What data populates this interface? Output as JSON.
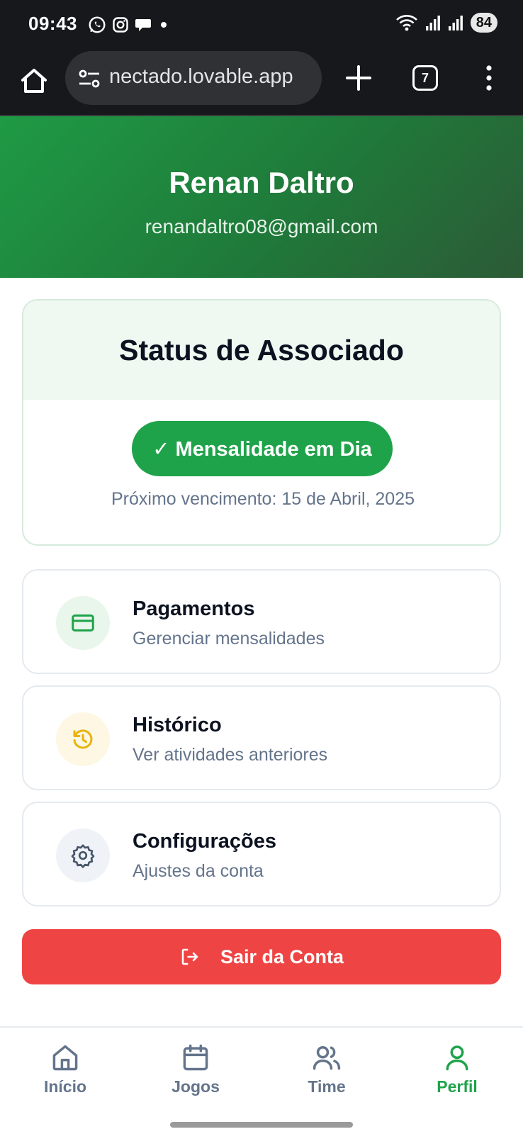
{
  "status_bar": {
    "time": "09:43",
    "notification_icons": [
      "whatsapp-icon",
      "instagram-icon",
      "chat-icon",
      "dot-icon"
    ],
    "battery": "84"
  },
  "browser": {
    "url": "nectado.lovable.app",
    "tab_count": "7"
  },
  "profile": {
    "name": "Renan Daltro",
    "email": "renandaltro08@gmail.com"
  },
  "status_card": {
    "title": "Status de Associado",
    "badge": "✓ Mensalidade em Dia",
    "due_text": "Próximo vencimento: 15 de Abril, 2025",
    "accent": "#1fa34a"
  },
  "menu": [
    {
      "title": "Pagamentos",
      "subtitle": "Gerenciar mensalidades",
      "icon": "credit-card-icon",
      "color": "#1fa34a"
    },
    {
      "title": "Histórico",
      "subtitle": "Ver atividades anteriores",
      "icon": "history-icon",
      "color": "#eab308"
    },
    {
      "title": "Configurações",
      "subtitle": "Ajustes da conta",
      "icon": "gear-icon",
      "color": "#475569"
    }
  ],
  "logout": {
    "label": "Sair da Conta",
    "color": "#ef4444"
  },
  "nav": [
    {
      "label": "Início",
      "icon": "home-icon",
      "active": false
    },
    {
      "label": "Jogos",
      "icon": "calendar-icon",
      "active": false
    },
    {
      "label": "Time",
      "icon": "users-icon",
      "active": false
    },
    {
      "label": "Perfil",
      "icon": "user-icon",
      "active": true
    }
  ]
}
